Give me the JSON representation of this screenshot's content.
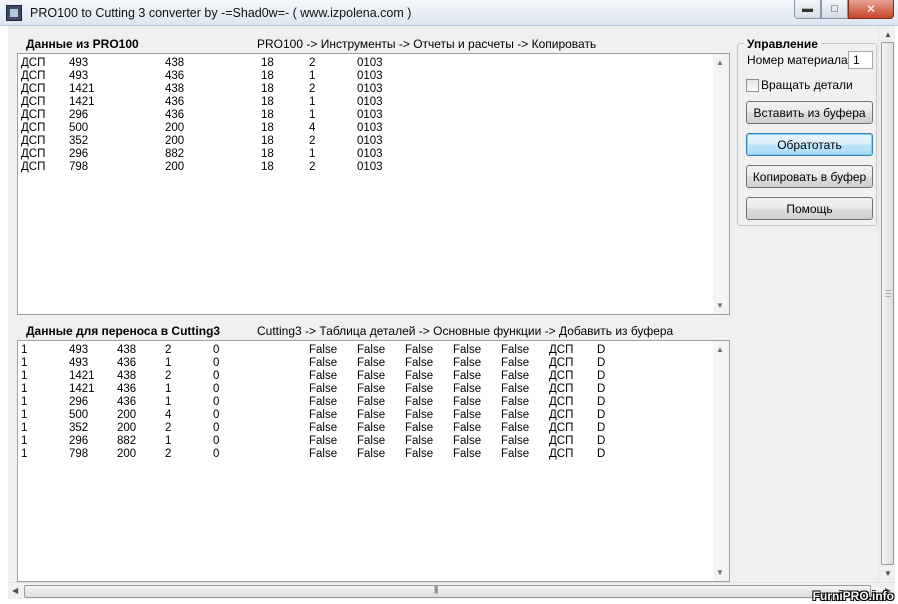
{
  "window": {
    "title": "PRO100 to Cutting 3 converter by -=Shad0w=- ( www.izpolena.com )"
  },
  "top_section": {
    "title": "Данные из PRO100",
    "hint": "PRO100 -> Инструменты -> Отчеты и расчеты -> Копировать",
    "rows": [
      [
        "ДСП",
        "493",
        "438",
        "18",
        "2",
        "0103"
      ],
      [
        "ДСП",
        "493",
        "436",
        "18",
        "1",
        "0103"
      ],
      [
        "ДСП",
        "1421",
        "438",
        "18",
        "2",
        "0103"
      ],
      [
        "ДСП",
        "1421",
        "436",
        "18",
        "1",
        "0103"
      ],
      [
        "ДСП",
        "296",
        "436",
        "18",
        "1",
        "0103"
      ],
      [
        "ДСП",
        "500",
        "200",
        "18",
        "4",
        "0103"
      ],
      [
        "ДСП",
        "352",
        "200",
        "18",
        "2",
        "0103"
      ],
      [
        "ДСП",
        "296",
        "882",
        "18",
        "1",
        "0103"
      ],
      [
        "ДСП",
        "798",
        "200",
        "18",
        "2",
        "0103"
      ]
    ]
  },
  "bottom_section": {
    "title": "Данные для переноса в Cutting3",
    "hint": "Cutting3 -> Таблица деталей -> Основные функции -> Добавить из буфера",
    "rows": [
      [
        "1",
        "493",
        "438",
        "2",
        "0",
        "False",
        "False",
        "False",
        "False",
        "False",
        "ДСП",
        "D"
      ],
      [
        "1",
        "493",
        "436",
        "1",
        "0",
        "False",
        "False",
        "False",
        "False",
        "False",
        "ДСП",
        "D"
      ],
      [
        "1",
        "1421",
        "438",
        "2",
        "0",
        "False",
        "False",
        "False",
        "False",
        "False",
        "ДСП",
        "D"
      ],
      [
        "1",
        "1421",
        "436",
        "1",
        "0",
        "False",
        "False",
        "False",
        "False",
        "False",
        "ДСП",
        "D"
      ],
      [
        "1",
        "296",
        "436",
        "1",
        "0",
        "False",
        "False",
        "False",
        "False",
        "False",
        "ДСП",
        "D"
      ],
      [
        "1",
        "500",
        "200",
        "4",
        "0",
        "False",
        "False",
        "False",
        "False",
        "False",
        "ДСП",
        "D"
      ],
      [
        "1",
        "352",
        "200",
        "2",
        "0",
        "False",
        "False",
        "False",
        "False",
        "False",
        "ДСП",
        "D"
      ],
      [
        "1",
        "296",
        "882",
        "1",
        "0",
        "False",
        "False",
        "False",
        "False",
        "False",
        "ДСП",
        "D"
      ],
      [
        "1",
        "798",
        "200",
        "2",
        "0",
        "False",
        "False",
        "False",
        "False",
        "False",
        "ДСП",
        "D"
      ]
    ]
  },
  "controls": {
    "group_title": "Управление",
    "material_label": "Номер материала:",
    "material_value": "1",
    "rotate_label": "Вращать детали",
    "rotate_checked": false,
    "paste_button": "Вставить из буфера",
    "process_button": "Обратотать",
    "copy_button": "Копировать в буфер",
    "help_button": "Помощь"
  },
  "watermark": "FurniPRO.info"
}
